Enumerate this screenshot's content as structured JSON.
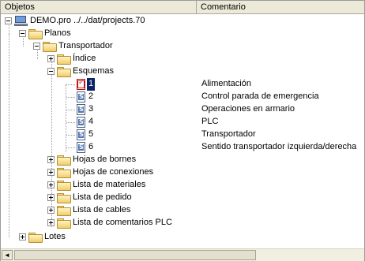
{
  "columns": {
    "objects": "Objetos",
    "comment": "Comentario"
  },
  "tree": {
    "root": {
      "label": "DEMO.pro ../../dat/projects.70",
      "icon": "computer-icon"
    },
    "planos": "Planos",
    "transportador": "Transportador",
    "indice": "Índice",
    "esquemas": "Esquemas",
    "pages": [
      {
        "label": "1",
        "comment": "Alimentación",
        "selected": true
      },
      {
        "label": "2",
        "comment": "Control parada de emergencia"
      },
      {
        "label": "3",
        "comment": "Operaciones en armario"
      },
      {
        "label": "4",
        "comment": "PLC"
      },
      {
        "label": "5",
        "comment": "Transportador"
      },
      {
        "label": "6",
        "comment": "Sentido transportador izquierda/derecha"
      }
    ],
    "folders": [
      "Hojas de bornes",
      "Hojas de conexiones",
      "Lista de materiales",
      "Lista de pedido",
      "Lista de cables",
      "Lista de comentarios PLC"
    ],
    "lotes": "Lotes"
  },
  "scrollbar": {
    "left_arrow": "◄"
  },
  "colors": {
    "selection": "#0a246a",
    "header": "#ece9d8"
  }
}
